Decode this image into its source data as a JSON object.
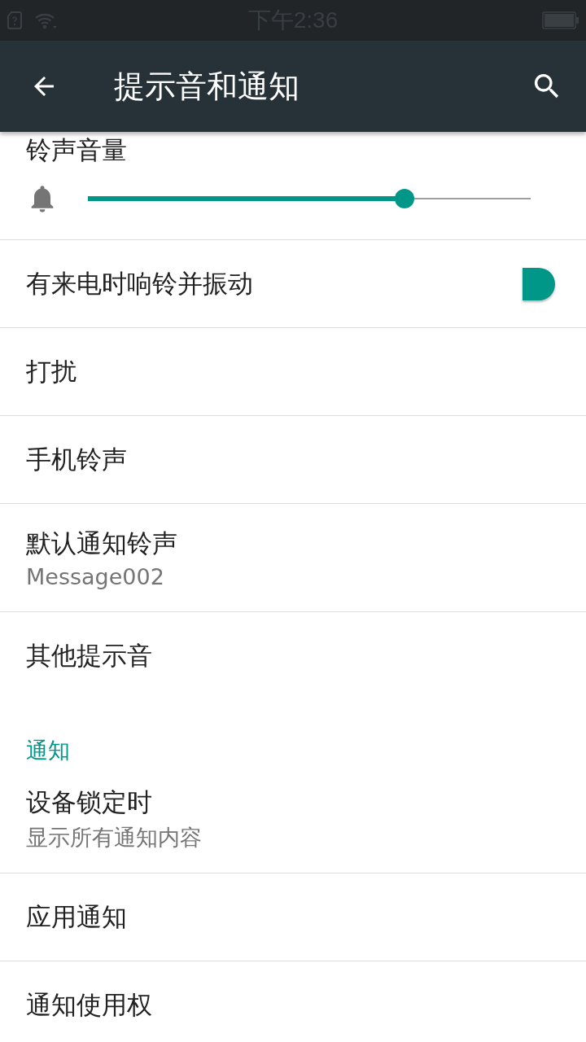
{
  "status_bar": {
    "time": "下午2:36"
  },
  "toolbar": {
    "title": "提示音和通知"
  },
  "items": [
    {
      "kind": "slider",
      "title": "铃声音量",
      "level": 0.715
    },
    {
      "kind": "switch",
      "title": "有来电时响铃并振动",
      "on": true
    },
    {
      "kind": "plain",
      "title": "打扰"
    },
    {
      "kind": "plain",
      "title": "手机铃声"
    },
    {
      "kind": "subtitle",
      "title": "默认通知铃声",
      "summary": "Message002"
    },
    {
      "kind": "plain",
      "title": "其他提示音"
    },
    {
      "kind": "header",
      "title": "通知"
    },
    {
      "kind": "subtitle",
      "title": "设备锁定时",
      "summary": "显示所有通知内容"
    },
    {
      "kind": "plain",
      "title": "应用通知"
    },
    {
      "kind": "plain",
      "title": "通知使用权"
    }
  ]
}
